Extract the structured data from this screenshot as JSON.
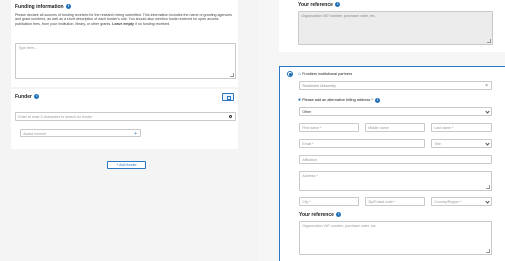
{
  "funding": {
    "title": "Funding information",
    "description_pre": "Please declare all sources of funding received for the research being submitted. This information includes the name of granting agencies and grant numbers, as well as a short description of each funder's role. You should also mention funds received for open access publication fees, from your institution, library, or other grants.",
    "description_bold": "Leave empty",
    "description_post": " if no funding received.",
    "textarea_placeholder": "Type here..."
  },
  "funder": {
    "title": "Funder",
    "search_placeholder": "Enter at least 3 characters to search for funder",
    "award_placeholder": "Award number",
    "add_award_symbol": "+",
    "add_funder_label": "+ Add funder"
  },
  "right_top": {
    "reference_title": "Your reference",
    "reference_placeholder": "Organization VAT number, purchase order, etc."
  },
  "billing": {
    "partners_label": "Frontiers institutional partners",
    "partners_value": "Stockholm University",
    "partners_clear": "×",
    "alt_address_label": "Please add an alternative billing address *",
    "type_value": "Other",
    "first_name": "First name *",
    "middle_name": "Middle name",
    "last_name": "Last name *",
    "email": "Email *",
    "title_select": "Title",
    "affiliation": "Affiliation",
    "address": "Address *",
    "city": "City *",
    "zip": "Zip/Postal code *",
    "country": "Country/Region *",
    "reference_title": "Your reference",
    "reference_placeholder": "Organization VAT number, purchase order, etc."
  },
  "colors": {
    "accent": "#1f6fb8",
    "panel_border": "#2b78c2",
    "background": "#f2f2f2"
  }
}
